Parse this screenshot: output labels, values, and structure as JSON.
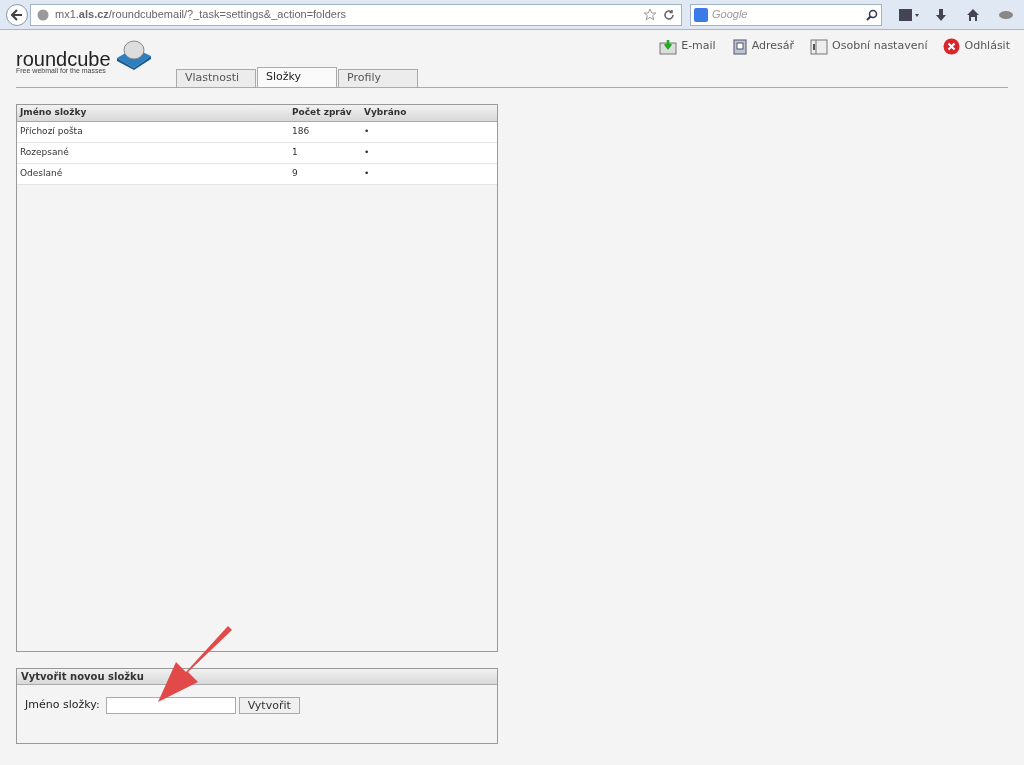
{
  "browser": {
    "url": "mx1.**als.cz**/roundcubemail/?_task=settings&_action=folders",
    "search_placeholder": "Google"
  },
  "logo": {
    "name": "roundcube",
    "tagline": "Free webmail for the masses"
  },
  "topnav": [
    {
      "kind": "mail",
      "label": "E-mail"
    },
    {
      "kind": "contacts",
      "label": "Adresář"
    },
    {
      "kind": "settings",
      "label": "Osobní nastavení"
    },
    {
      "kind": "logout",
      "label": "Odhlásit"
    }
  ],
  "tabs": [
    {
      "label": "Vlastnosti",
      "selected": false
    },
    {
      "label": "Složky",
      "selected": true
    },
    {
      "label": "Profily",
      "selected": false
    }
  ],
  "table": {
    "columns": [
      "Jméno složky",
      "Počet zpráv",
      "Vybráno"
    ],
    "rows": [
      [
        "Příchozí pošta",
        "186",
        "•"
      ],
      [
        "Rozepsané",
        "1",
        "•"
      ],
      [
        "Odeslané",
        "9",
        "•"
      ]
    ]
  },
  "create": {
    "title": "Vytvořit novou složku",
    "label": "Jméno složky:",
    "button": "Vytvořit"
  }
}
